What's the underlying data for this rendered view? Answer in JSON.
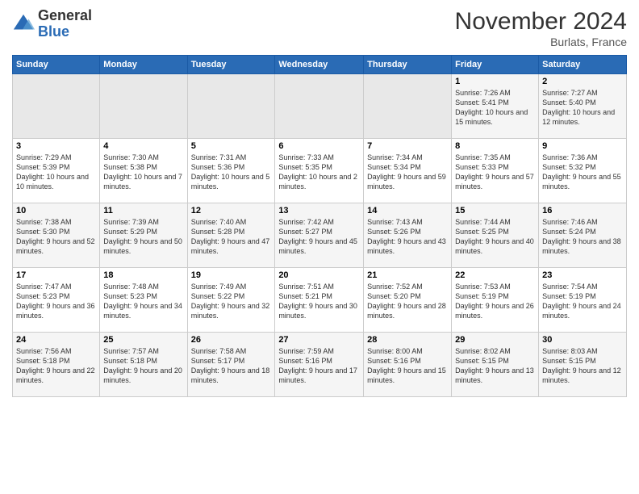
{
  "logo": {
    "general": "General",
    "blue": "Blue"
  },
  "header": {
    "title": "November 2024",
    "subtitle": "Burlats, France"
  },
  "days_of_week": [
    "Sunday",
    "Monday",
    "Tuesday",
    "Wednesday",
    "Thursday",
    "Friday",
    "Saturday"
  ],
  "weeks": [
    [
      {
        "day": "",
        "info": ""
      },
      {
        "day": "",
        "info": ""
      },
      {
        "day": "",
        "info": ""
      },
      {
        "day": "",
        "info": ""
      },
      {
        "day": "",
        "info": ""
      },
      {
        "day": "1",
        "info": "Sunrise: 7:26 AM\nSunset: 5:41 PM\nDaylight: 10 hours and 15 minutes."
      },
      {
        "day": "2",
        "info": "Sunrise: 7:27 AM\nSunset: 5:40 PM\nDaylight: 10 hours and 12 minutes."
      }
    ],
    [
      {
        "day": "3",
        "info": "Sunrise: 7:29 AM\nSunset: 5:39 PM\nDaylight: 10 hours and 10 minutes."
      },
      {
        "day": "4",
        "info": "Sunrise: 7:30 AM\nSunset: 5:38 PM\nDaylight: 10 hours and 7 minutes."
      },
      {
        "day": "5",
        "info": "Sunrise: 7:31 AM\nSunset: 5:36 PM\nDaylight: 10 hours and 5 minutes."
      },
      {
        "day": "6",
        "info": "Sunrise: 7:33 AM\nSunset: 5:35 PM\nDaylight: 10 hours and 2 minutes."
      },
      {
        "day": "7",
        "info": "Sunrise: 7:34 AM\nSunset: 5:34 PM\nDaylight: 9 hours and 59 minutes."
      },
      {
        "day": "8",
        "info": "Sunrise: 7:35 AM\nSunset: 5:33 PM\nDaylight: 9 hours and 57 minutes."
      },
      {
        "day": "9",
        "info": "Sunrise: 7:36 AM\nSunset: 5:32 PM\nDaylight: 9 hours and 55 minutes."
      }
    ],
    [
      {
        "day": "10",
        "info": "Sunrise: 7:38 AM\nSunset: 5:30 PM\nDaylight: 9 hours and 52 minutes."
      },
      {
        "day": "11",
        "info": "Sunrise: 7:39 AM\nSunset: 5:29 PM\nDaylight: 9 hours and 50 minutes."
      },
      {
        "day": "12",
        "info": "Sunrise: 7:40 AM\nSunset: 5:28 PM\nDaylight: 9 hours and 47 minutes."
      },
      {
        "day": "13",
        "info": "Sunrise: 7:42 AM\nSunset: 5:27 PM\nDaylight: 9 hours and 45 minutes."
      },
      {
        "day": "14",
        "info": "Sunrise: 7:43 AM\nSunset: 5:26 PM\nDaylight: 9 hours and 43 minutes."
      },
      {
        "day": "15",
        "info": "Sunrise: 7:44 AM\nSunset: 5:25 PM\nDaylight: 9 hours and 40 minutes."
      },
      {
        "day": "16",
        "info": "Sunrise: 7:46 AM\nSunset: 5:24 PM\nDaylight: 9 hours and 38 minutes."
      }
    ],
    [
      {
        "day": "17",
        "info": "Sunrise: 7:47 AM\nSunset: 5:23 PM\nDaylight: 9 hours and 36 minutes."
      },
      {
        "day": "18",
        "info": "Sunrise: 7:48 AM\nSunset: 5:23 PM\nDaylight: 9 hours and 34 minutes."
      },
      {
        "day": "19",
        "info": "Sunrise: 7:49 AM\nSunset: 5:22 PM\nDaylight: 9 hours and 32 minutes."
      },
      {
        "day": "20",
        "info": "Sunrise: 7:51 AM\nSunset: 5:21 PM\nDaylight: 9 hours and 30 minutes."
      },
      {
        "day": "21",
        "info": "Sunrise: 7:52 AM\nSunset: 5:20 PM\nDaylight: 9 hours and 28 minutes."
      },
      {
        "day": "22",
        "info": "Sunrise: 7:53 AM\nSunset: 5:19 PM\nDaylight: 9 hours and 26 minutes."
      },
      {
        "day": "23",
        "info": "Sunrise: 7:54 AM\nSunset: 5:19 PM\nDaylight: 9 hours and 24 minutes."
      }
    ],
    [
      {
        "day": "24",
        "info": "Sunrise: 7:56 AM\nSunset: 5:18 PM\nDaylight: 9 hours and 22 minutes."
      },
      {
        "day": "25",
        "info": "Sunrise: 7:57 AM\nSunset: 5:18 PM\nDaylight: 9 hours and 20 minutes."
      },
      {
        "day": "26",
        "info": "Sunrise: 7:58 AM\nSunset: 5:17 PM\nDaylight: 9 hours and 18 minutes."
      },
      {
        "day": "27",
        "info": "Sunrise: 7:59 AM\nSunset: 5:16 PM\nDaylight: 9 hours and 17 minutes."
      },
      {
        "day": "28",
        "info": "Sunrise: 8:00 AM\nSunset: 5:16 PM\nDaylight: 9 hours and 15 minutes."
      },
      {
        "day": "29",
        "info": "Sunrise: 8:02 AM\nSunset: 5:15 PM\nDaylight: 9 hours and 13 minutes."
      },
      {
        "day": "30",
        "info": "Sunrise: 8:03 AM\nSunset: 5:15 PM\nDaylight: 9 hours and 12 minutes."
      }
    ]
  ]
}
